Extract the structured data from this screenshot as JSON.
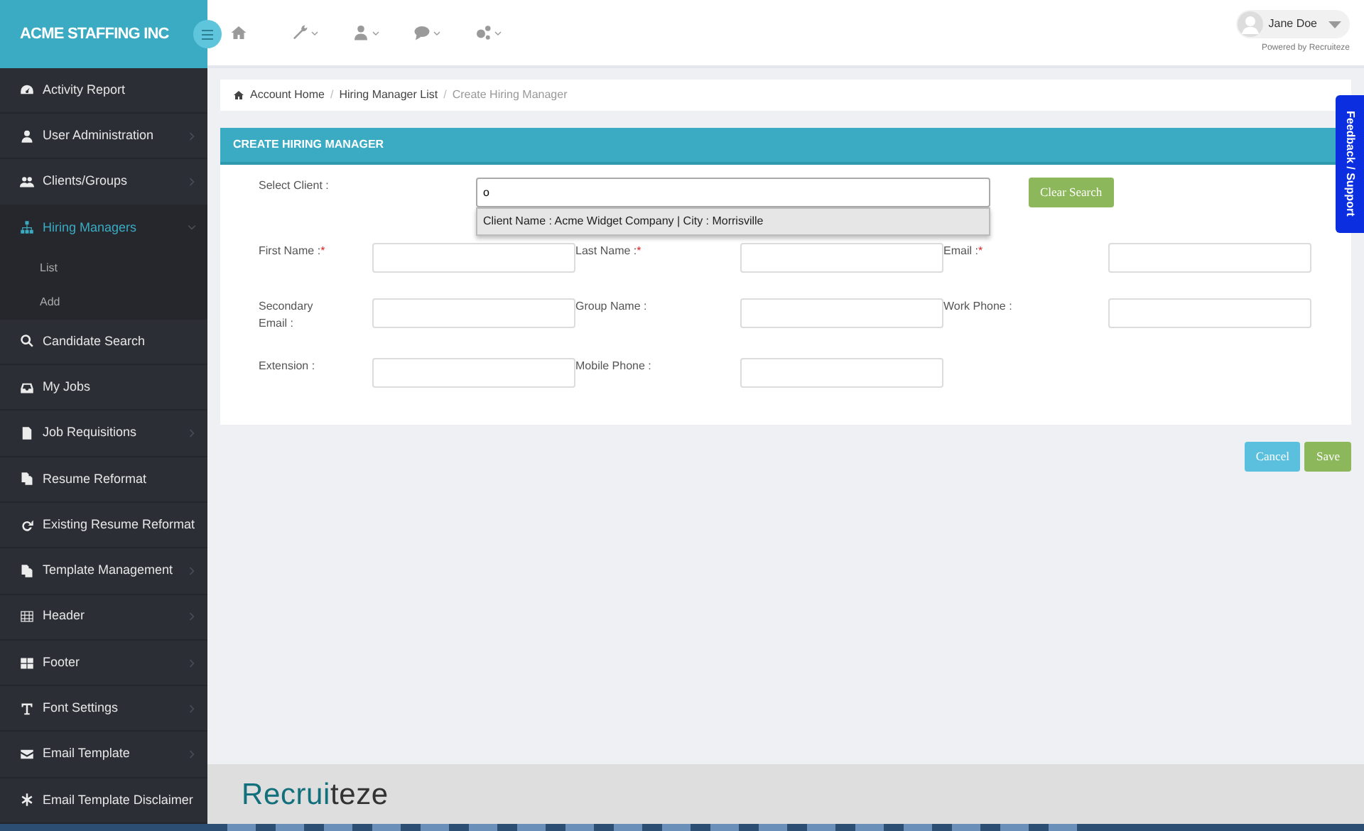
{
  "brand": "ACME STAFFING INC",
  "top_nav": [
    {
      "caret": false
    },
    {
      "caret": true
    },
    {
      "caret": true
    },
    {
      "caret": true
    },
    {
      "caret": true
    }
  ],
  "user": {
    "name": "Jane Doe",
    "powered_by": "Powered by Recruiteze"
  },
  "sidebar": {
    "items": [
      {
        "label": "Activity Report",
        "has_submenu": false,
        "selected": false
      },
      {
        "label": "User Administration",
        "has_submenu": true,
        "selected": false,
        "expanded": false
      },
      {
        "label": "Clients/Groups",
        "has_submenu": true,
        "selected": false,
        "expanded": false
      },
      {
        "label": "Hiring Managers",
        "has_submenu": true,
        "selected": true,
        "expanded": true,
        "children": [
          {
            "label": "List"
          },
          {
            "label": "Add"
          }
        ]
      },
      {
        "label": "Candidate Search",
        "has_submenu": false,
        "selected": false
      },
      {
        "label": "My Jobs",
        "has_submenu": false,
        "selected": false
      },
      {
        "label": "Job Requisitions",
        "has_submenu": true,
        "selected": false,
        "expanded": false
      },
      {
        "label": "Resume Reformat",
        "has_submenu": false,
        "selected": false
      },
      {
        "label": "Existing Resume Reformat",
        "has_submenu": false,
        "selected": false
      },
      {
        "label": "Template Management",
        "has_submenu": true,
        "selected": false,
        "expanded": false
      },
      {
        "label": "Header",
        "has_submenu": true,
        "selected": false,
        "expanded": false
      },
      {
        "label": "Footer",
        "has_submenu": true,
        "selected": false,
        "expanded": false
      },
      {
        "label": "Font Settings",
        "has_submenu": true,
        "selected": false,
        "expanded": false
      },
      {
        "label": "Email Template",
        "has_submenu": true,
        "selected": false,
        "expanded": false
      },
      {
        "label": "Email Template Disclaimer",
        "has_submenu": false,
        "selected": false
      }
    ]
  },
  "breadcrumb": [
    {
      "kind": "link",
      "label": "Account Home"
    },
    {
      "kind": "separator",
      "label": "/"
    },
    {
      "kind": "link",
      "label": "Hiring Manager List"
    },
    {
      "kind": "separator",
      "label": "/"
    },
    {
      "kind": "current",
      "label": "Create Hiring Manager"
    }
  ],
  "panel": {
    "title": "CREATE HIRING MANAGER",
    "select_client": {
      "label": "Select Client :",
      "value": "o",
      "suggestions": [
        "Client Name : Acme Widget Company | City : Morrisville"
      ],
      "clear_button": "Clear Search"
    },
    "fields": [
      {
        "label": "First Name :",
        "required_mark": "*"
      },
      {
        "label": "Last Name :",
        "required_mark": "*"
      },
      {
        "label": "Email :",
        "required_mark": "*"
      },
      {
        "label": "Secondary Email :"
      },
      {
        "label": "Group Name :"
      },
      {
        "label": "Work Phone :"
      },
      {
        "label": "Extension :"
      },
      {
        "label": "Mobile Phone :"
      }
    ]
  },
  "buttons": [
    {
      "label": "Cancel",
      "kind": "info"
    },
    {
      "label": "Save",
      "kind": "success"
    }
  ],
  "feedback_tab": "Feedback / Support",
  "footer_logo": [
    {
      "text": "Recrui",
      "color": "#12707c"
    },
    {
      "text": "teze",
      "color": "#333333"
    }
  ]
}
